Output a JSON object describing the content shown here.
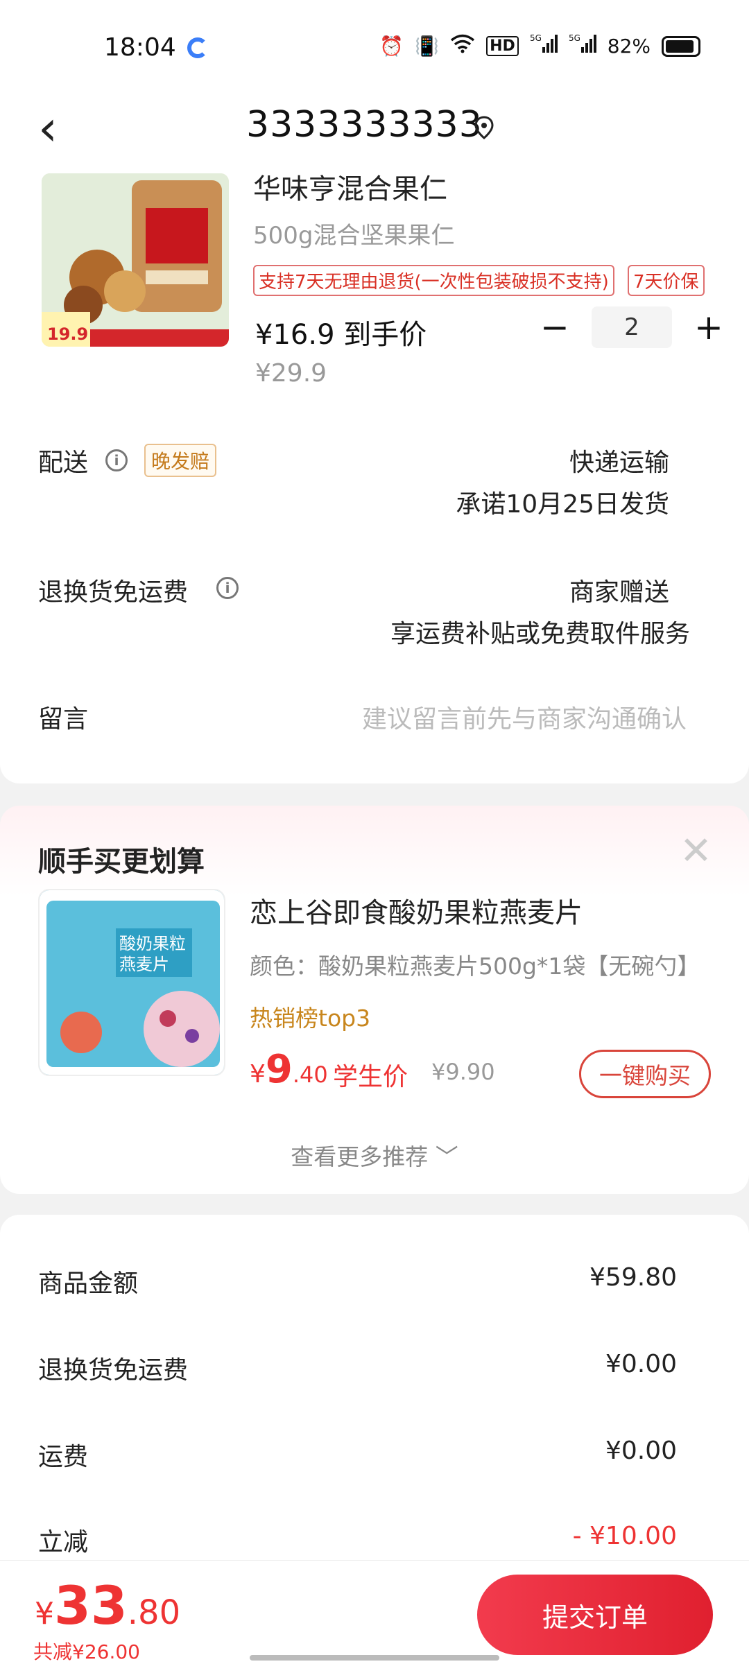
{
  "status_bar": {
    "time": "18:04",
    "battery": "82%",
    "icons": [
      "alarm-icon",
      "vibrate-icon",
      "wifi-icon",
      "hd-icon",
      "5g-signal-icon",
      "5g-signal-icon",
      "battery-icon"
    ]
  },
  "nav": {
    "back": "‹",
    "title": "3333333333"
  },
  "product": {
    "name": "华味亨混合果仁",
    "spec": "500g混合坚果果仁",
    "tags": [
      "支持7天无理由退货(一次性包装破损不支持)",
      "7天价保"
    ],
    "price_label": "¥16.9 到手价",
    "original_price": "¥29.9",
    "quantity": "2",
    "minus": "−",
    "plus": "+"
  },
  "delivery": {
    "label": "配送",
    "badge": "晚发赔",
    "method": "快递运输",
    "promise": "承诺10月25日发货"
  },
  "return_shipping": {
    "label": "退换货免运费",
    "value_line1": "商家赠送",
    "value_line2": "享运费补贴或免费取件服务"
  },
  "message": {
    "label": "留言",
    "placeholder": "建议留言前先与商家沟通确认"
  },
  "recommend": {
    "title": "顺手买更划算",
    "close": "✕",
    "item": {
      "name": "恋上谷即食酸奶果粒燕麦片",
      "color": "颜色：酸奶果粒燕麦片500g*1袋【无碗勺】",
      "rank": "热销榜top3",
      "price_currency": "¥",
      "price_int": "9",
      "price_dec": ".40",
      "price_label": "学生价",
      "original_price": "¥9.90",
      "buy_label": "一键购买"
    },
    "more": "查看更多推荐 ﹀"
  },
  "summary": {
    "rows": [
      {
        "label": "商品金额",
        "value": "¥59.80"
      },
      {
        "label": "退换货免运费",
        "value": "¥0.00"
      },
      {
        "label": "运费",
        "value": "¥0.00"
      },
      {
        "label": "立减",
        "value": "- ¥10.00"
      }
    ]
  },
  "footer": {
    "currency": "¥",
    "total_int": "33",
    "total_dec": ".80",
    "saved": "共减¥26.00",
    "submit": "提交订单"
  },
  "colors": {
    "accent_red": "#e33333",
    "gold": "#c8861d"
  }
}
